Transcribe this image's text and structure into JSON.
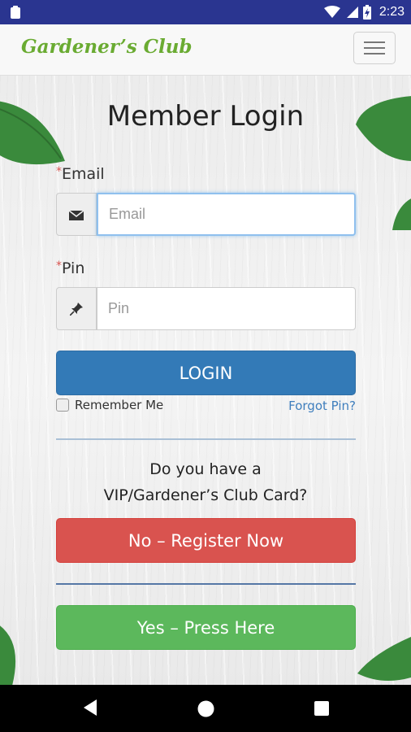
{
  "status_bar": {
    "time": "2:23",
    "icons": [
      "clipboard-icon",
      "wifi-icon",
      "cellular-icon",
      "battery-charging-icon"
    ]
  },
  "app_bar": {
    "brand": "Gardener’s Club",
    "menu_icon": "hamburger-menu-icon"
  },
  "login": {
    "title": "Member Login",
    "required_marker": "*",
    "email_label": "Email",
    "email_placeholder": "Email",
    "email_value": "",
    "email_icon": "envelope-icon",
    "pin_label": "Pin",
    "pin_placeholder": "Pin",
    "pin_value": "",
    "pin_icon": "pushpin-icon",
    "login_button": "LOGIN",
    "remember_me": "Remember Me",
    "remember_checked": false,
    "forgot_pin": "Forgot Pin?"
  },
  "card": {
    "question_line1": "Do you have a",
    "question_line2": "VIP/Gardener’s Club Card?",
    "register_button": "No – Register Now",
    "yes_button": "Yes – Press Here"
  },
  "colors": {
    "status_bar": "#2a3590",
    "brand_green": "#6aab32",
    "login_blue": "#337ab7",
    "register_red": "#d9534f",
    "yes_green": "#5cb85c",
    "link_blue": "#3f7ebd",
    "required_red": "#d9534f"
  },
  "nav_bar": {
    "icons": [
      "back-triangle-icon",
      "home-circle-icon",
      "recents-square-icon"
    ]
  }
}
